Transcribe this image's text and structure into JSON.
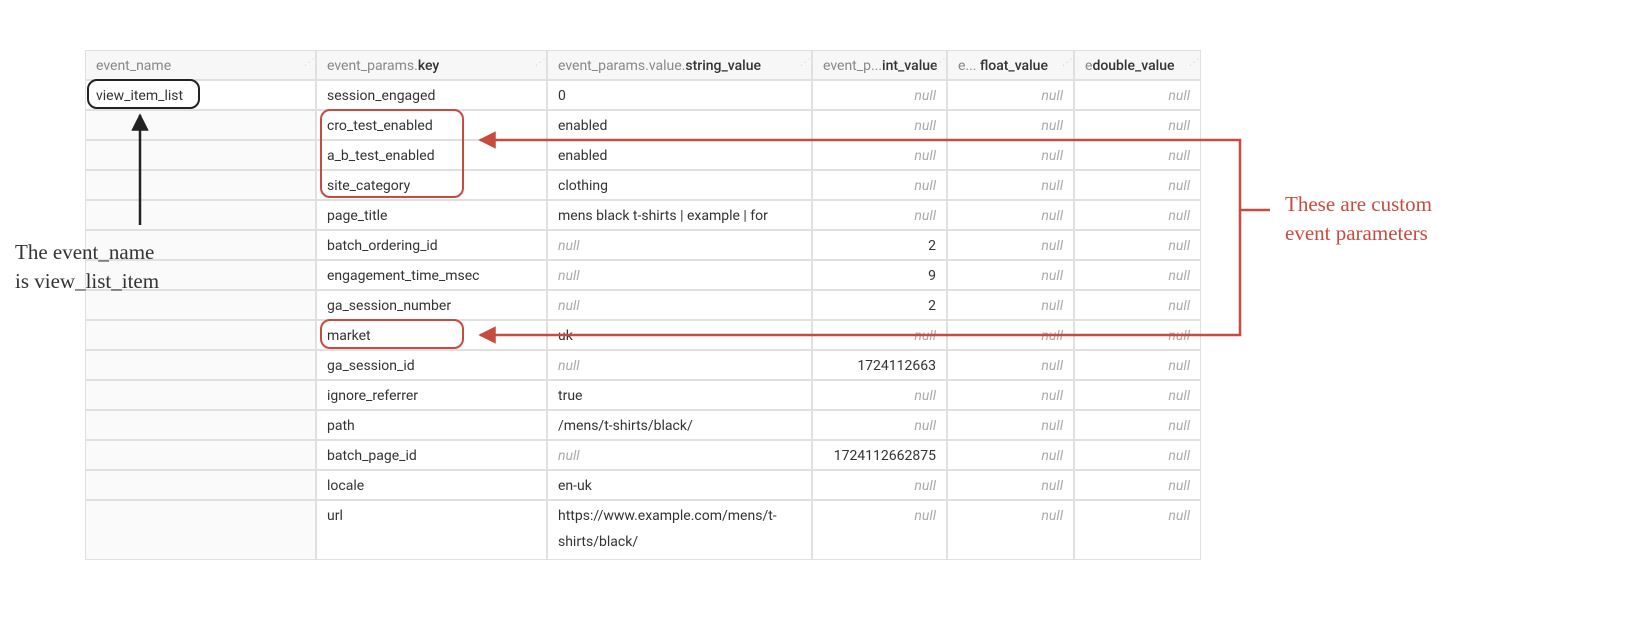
{
  "headers": {
    "event_name": "event_name",
    "key_prefix": "event_params.",
    "key_bold": "key",
    "string_prefix": "event_params.value.",
    "string_bold": "string_value",
    "int_prefix": "event_p...",
    "int_bold": "int_value",
    "float_prefix": "e... ",
    "float_bold": "float_value",
    "double_prefix": "e",
    "double_bold": "double_value"
  },
  "event_name_value": "view_item_list",
  "rows": [
    {
      "key": "session_engaged",
      "str": "0",
      "int": "null",
      "float_null": true,
      "double_null": true,
      "str_null": false,
      "int_null": true
    },
    {
      "key": "cro_test_enabled",
      "str": "enabled",
      "int": "null",
      "float_null": true,
      "double_null": true,
      "str_null": false,
      "int_null": true
    },
    {
      "key": "a_b_test_enabled",
      "str": "enabled",
      "int": "null",
      "float_null": true,
      "double_null": true,
      "str_null": false,
      "int_null": true
    },
    {
      "key": "site_category",
      "str": "clothing",
      "int": "null",
      "float_null": true,
      "double_null": true,
      "str_null": false,
      "int_null": true
    },
    {
      "key": "page_title",
      "str": "mens black t-shirts | example | for",
      "int": "null",
      "float_null": true,
      "double_null": true,
      "str_null": false,
      "int_null": true
    },
    {
      "key": "batch_ordering_id",
      "str": "null",
      "int": "2",
      "float_null": true,
      "double_null": true,
      "str_null": true,
      "int_null": false
    },
    {
      "key": "engagement_time_msec",
      "str": "null",
      "int": "9",
      "float_null": true,
      "double_null": true,
      "str_null": true,
      "int_null": false
    },
    {
      "key": "ga_session_number",
      "str": "null",
      "int": "2",
      "float_null": true,
      "double_null": true,
      "str_null": true,
      "int_null": false
    },
    {
      "key": "market",
      "str": "uk",
      "int": "null",
      "float_null": true,
      "double_null": true,
      "str_null": false,
      "int_null": true
    },
    {
      "key": "ga_session_id",
      "str": "null",
      "int": "1724112663",
      "float_null": true,
      "double_null": true,
      "str_null": true,
      "int_null": false
    },
    {
      "key": "ignore_referrer",
      "str": "true",
      "int": "null",
      "float_null": true,
      "double_null": true,
      "str_null": false,
      "int_null": true
    },
    {
      "key": "path",
      "str": "/mens/t-shirts/black/",
      "int": "null",
      "float_null": true,
      "double_null": true,
      "str_null": false,
      "int_null": true
    },
    {
      "key": "batch_page_id",
      "str": "null",
      "int": "1724112662875",
      "float_null": true,
      "double_null": true,
      "str_null": true,
      "int_null": false
    },
    {
      "key": "locale",
      "str": "en-uk",
      "int": "null",
      "float_null": true,
      "double_null": true,
      "str_null": false,
      "int_null": true
    },
    {
      "key": "url",
      "str": "https://www.example.com/mens/t-shirts/black/",
      "int": "null",
      "float_null": true,
      "double_null": true,
      "str_null": false,
      "int_null": true,
      "tall": true
    }
  ],
  "null_text": "null",
  "annotations": {
    "left_line1": "The event_name",
    "left_line2": "is view_list_item",
    "right_line1": "These are custom",
    "right_line2": "event parameters"
  }
}
